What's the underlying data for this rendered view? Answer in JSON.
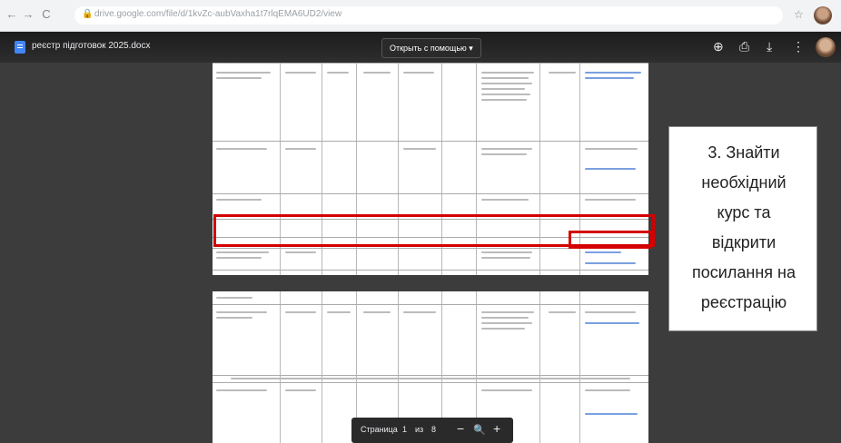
{
  "browser": {
    "url": "drive.google.com/file/d/1kvZc-aubVaxha1t7rlqEMA6UD2/view",
    "back": "←",
    "forward": "→",
    "reload": "C",
    "lock": "🔒",
    "star": "☆"
  },
  "viewer": {
    "file_name": "реєстр підготовок 2025.docx",
    "open_with": "Открыть с помощью ▾",
    "tool_add": "⊕",
    "tool_print": "⎙",
    "tool_download": "⤓",
    "tool_more": "⋮"
  },
  "callout": {
    "lines": [
      "3. Знайти",
      "необхідний",
      "курс та",
      "відкрити",
      "посилання на",
      "реєстрацію"
    ]
  },
  "pager": {
    "label": "Страница",
    "current": "1",
    "sep": "из",
    "total": "8",
    "minus": "−",
    "zoom": "🔍",
    "plus": "+"
  }
}
